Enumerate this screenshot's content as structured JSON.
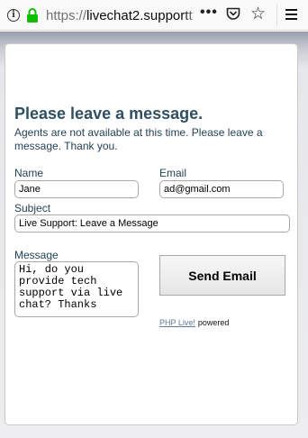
{
  "browser": {
    "url_scheme": "https://",
    "url_host": "livechat2.support",
    "url_rest": "t"
  },
  "form": {
    "title": "Please leave a message.",
    "subtitle": "Agents are not available at this time. Please leave a message. Thank you.",
    "name_label": "Name",
    "name_value": "Jane",
    "email_label": "Email",
    "email_value": "ad@gmail.com",
    "subject_label": "Subject",
    "subject_value": "Live Support: Leave a Message",
    "message_label": "Message",
    "message_value": "Hi, do you\nprovide tech\nsupport via live\nchat? Thanks",
    "send_button": "Send Email",
    "powered_link": "PHP Live!",
    "powered_text": "powered"
  },
  "colors": {
    "heading": "#2f5060",
    "label": "#1f3f55",
    "lock": "#12bc00"
  }
}
